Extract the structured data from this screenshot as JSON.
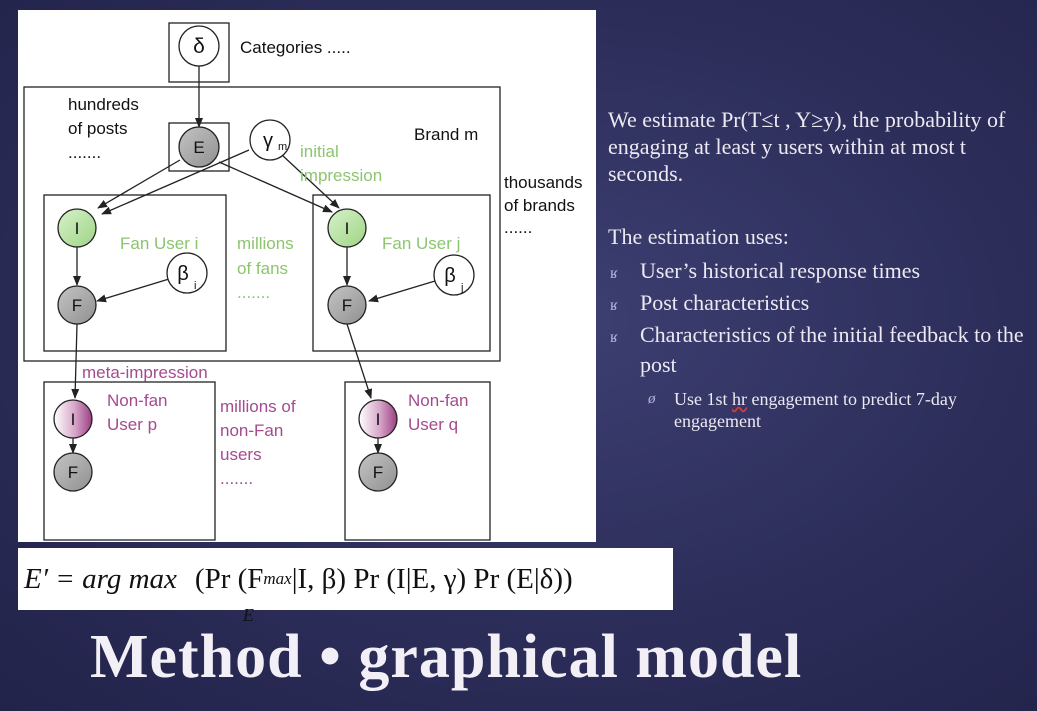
{
  "diagram": {
    "nodes": {
      "delta": "δ",
      "e": "E",
      "gamma": "γ",
      "gamma_sub": "m",
      "i_left": "I",
      "f_left": "F",
      "beta_left": "β",
      "beta_left_sub": "i",
      "i_right": "I",
      "f_right": "F",
      "beta_right": "β",
      "beta_right_sub": "j",
      "i_nonfan_p": "I",
      "f_nonfan_p": "F",
      "i_nonfan_q": "I",
      "f_nonfan_q": "F"
    },
    "labels": {
      "categories": "Categories .....",
      "hundreds_1": "hundreds",
      "hundreds_2": "of posts",
      "hundreds_3": ".......",
      "brand": "Brand m",
      "initial_1": "initial",
      "initial_2": "impression",
      "thousands_1": "thousands",
      "thousands_2": "of brands",
      "thousands_3": "......",
      "fan_user_i": "Fan User i",
      "fan_user_j": "Fan User j",
      "millions_fans_1": "millions",
      "millions_fans_2": "of fans",
      "millions_fans_3": ".......",
      "meta_impression": "meta-impression",
      "nonfan_p_1": "Non-fan",
      "nonfan_p_2": "User p",
      "nonfan_q_1": "Non-fan",
      "nonfan_q_2": "User q",
      "millions_nonfan_1": "millions of",
      "millions_nonfan_2": "non-Fan",
      "millions_nonfan_3": "users",
      "millions_nonfan_4": "......."
    },
    "colors": {
      "green_node": "#b7e3a4",
      "gray_node": "#a9a9a9",
      "purple_node": "#a64d8e",
      "green_text": "#8cc56f",
      "purple_text": "#a54b8d"
    }
  },
  "formula": {
    "lhs": "E′ = arg max",
    "under": "E",
    "body_a": "(Pr (F",
    "body_sub": "max",
    "body_b": "|I, β) Pr (I|E, γ) Pr (E|δ))"
  },
  "right": {
    "intro": "We estimate Pr(T≤t , Y≥y), the probability of engaging at least y users within at most t seconds.",
    "uses_title": "The estimation uses:",
    "bullets": [
      "User’s historical response times",
      "Post characteristics",
      "Characteristics of the initial feedback to the post"
    ],
    "sub_bullet_a": "Use 1st ",
    "sub_bullet_squiggle": "hr",
    "sub_bullet_b": " engagement to predict 7-day engagement",
    "bullet_glyph": "ʁ",
    "sub_glyph": "ø"
  },
  "title": "Method • graphical model"
}
